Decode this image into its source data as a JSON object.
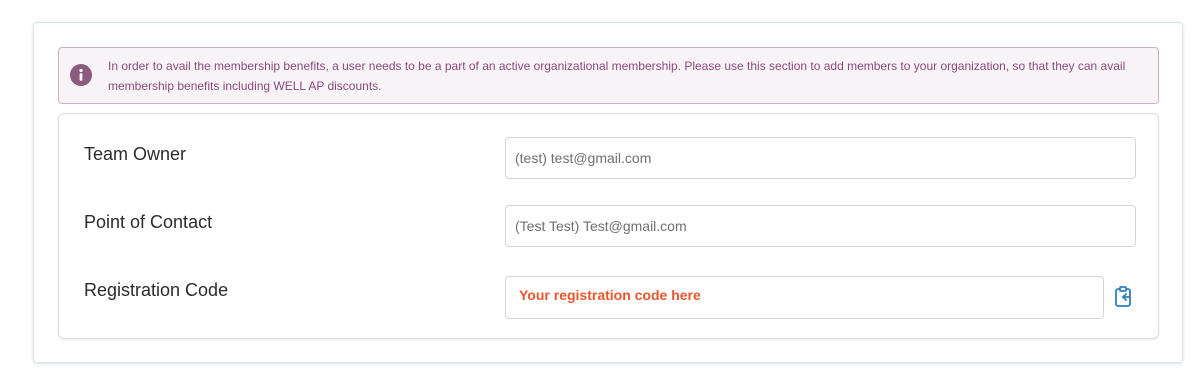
{
  "alert": {
    "icon": "info-icon",
    "text": "In order to avail the membership benefits, a user needs to be a part of an active organizational membership. Please use this section to add members to your organization, so that they can avail membership benefits including WELL AP discounts."
  },
  "form": {
    "team_owner": {
      "label": "Team Owner",
      "value": "(test) test@gmail.com"
    },
    "point_of_contact": {
      "label": "Point of Contact",
      "value": "(Test Test) Test@gmail.com"
    },
    "registration_code": {
      "label": "Registration Code",
      "value": "Your registration code here",
      "copy_icon": "clipboard-copy-icon"
    }
  },
  "colors": {
    "alert_text": "#8b4a7c",
    "alert_icon": "#8b5a7e",
    "code_text": "#e9562e",
    "copy_icon": "#2f7fc0"
  }
}
